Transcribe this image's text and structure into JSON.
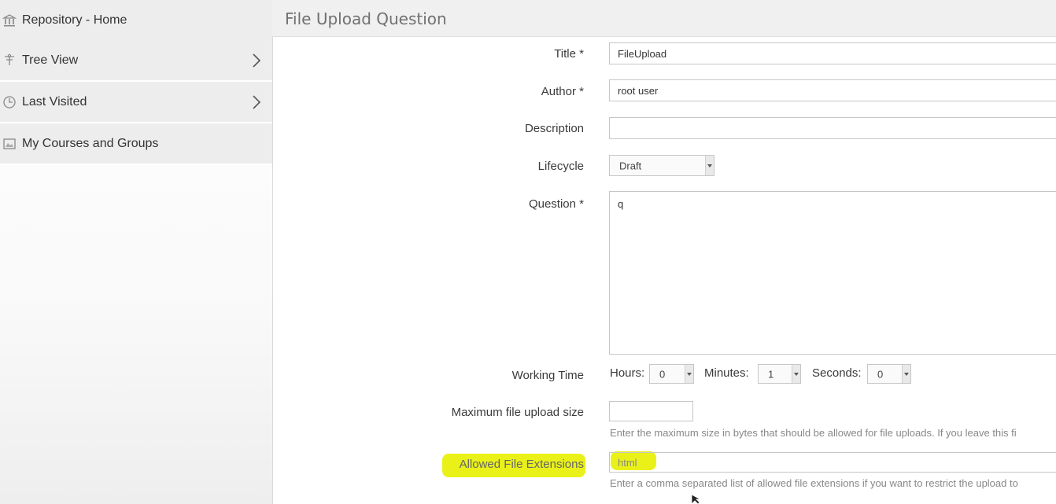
{
  "sidebar": {
    "items": [
      {
        "label": "Repository - Home",
        "icon": "repository-icon",
        "has_arrow": false
      },
      {
        "label": "Tree View",
        "icon": "tree-view-icon",
        "has_arrow": true
      },
      {
        "label": "Last Visited",
        "icon": "clock-icon",
        "has_arrow": true
      },
      {
        "label": "My Courses and Groups",
        "icon": "courses-icon",
        "has_arrow": false
      }
    ]
  },
  "main": {
    "title": "File Upload Question",
    "form": {
      "title_label": "Title *",
      "title_value": "FileUpload",
      "author_label": "Author *",
      "author_value": "root user",
      "description_label": "Description",
      "description_value": "",
      "lifecycle_label": "Lifecycle",
      "lifecycle_value": "Draft",
      "question_label": "Question *",
      "question_value": "q",
      "working_time_label": "Working Time",
      "hours_label": "Hours:",
      "hours_value": "0",
      "minutes_label": "Minutes:",
      "minutes_value": "1",
      "seconds_label": "Seconds:",
      "seconds_value": "0",
      "max_size_label": "Maximum file upload size",
      "max_size_value": "",
      "max_size_help": "Enter the maximum size in bytes that should be allowed for file uploads. If you leave this fi",
      "extensions_label": "Allowed File Extensions",
      "extensions_value": "html",
      "extensions_help": "Enter a comma separated list of allowed file extensions if you want to restrict the upload to"
    }
  },
  "colors": {
    "sidebar_item_bg": "#ededed",
    "header_bg": "#f0f0f0",
    "highlight": "#e8f000"
  }
}
